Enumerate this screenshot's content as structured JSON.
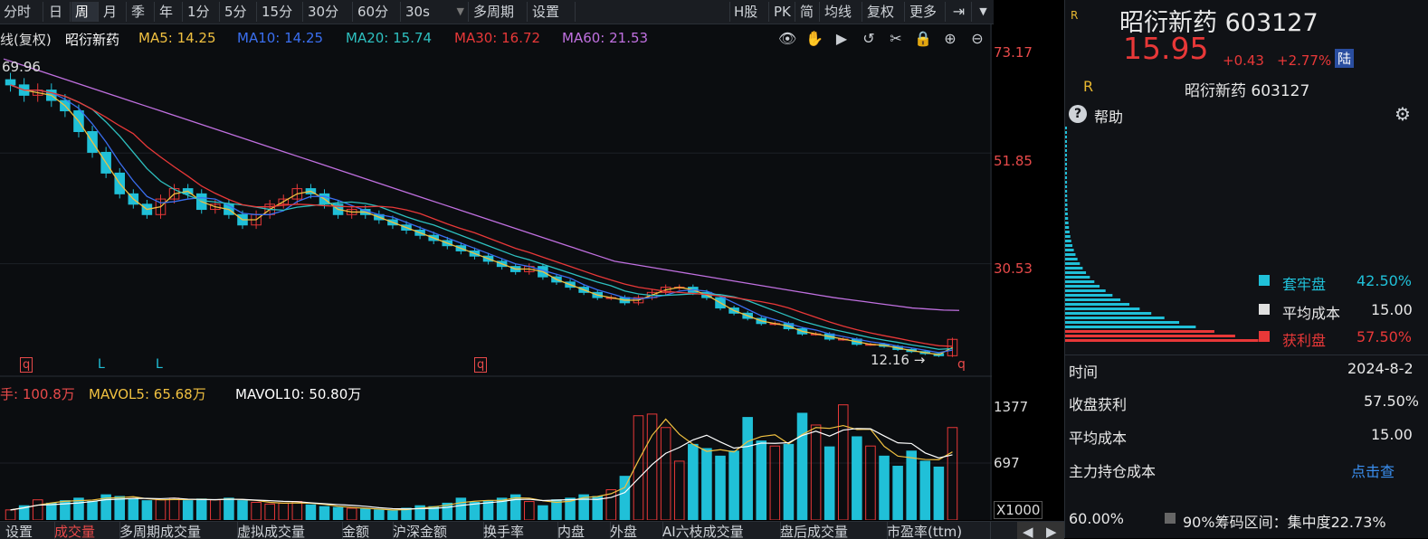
{
  "toolbar": {
    "items": [
      "分时",
      "日",
      "周",
      "月",
      "季",
      "年",
      "1分",
      "5分",
      "15分",
      "30分",
      "60分",
      "30s",
      "多周期",
      "设置"
    ],
    "right_items": [
      "H股",
      "PK",
      "简",
      "均线",
      "复权",
      "更多"
    ]
  },
  "chart": {
    "header_prefix": "线(复权)",
    "stock_name": "昭衍新药",
    "ma5": "MA5: 14.25",
    "ma10": "MA10: 14.25",
    "ma20": "MA20: 15.74",
    "ma30": "MA30: 16.72",
    "ma60": "MA60: 21.53",
    "max_label": "69.96",
    "min_label": "12.16",
    "y_ticks": [
      "73.17",
      "51.85",
      "30.53"
    ],
    "markers": [
      "q",
      "L",
      "L",
      "q",
      "q"
    ],
    "colors": {
      "ma5": "#f0c040",
      "ma10": "#3a6ff0",
      "ma20": "#2ec0c0",
      "ma30": "#e83838",
      "ma60": "#c070e0",
      "up": "#e83838",
      "down": "#20c0d8"
    }
  },
  "volume": {
    "vol_label": "手: 100.8万",
    "mavol5": "MAVOL5: 65.68万",
    "mavol10": "MAVOL10: 50.80万",
    "y_ticks": [
      "1377",
      "697"
    ],
    "unit": "X1000"
  },
  "chart_data": {
    "type": "candlestick",
    "y_range": [
      12.16,
      73.17
    ],
    "closes": [
      65,
      63,
      64,
      62,
      60,
      56,
      52,
      48,
      44,
      42,
      40,
      43,
      45,
      44,
      41,
      42,
      40,
      38,
      40,
      42,
      43,
      45,
      44,
      42,
      40,
      41,
      40,
      39,
      38,
      37,
      36,
      35,
      34,
      33,
      32,
      31,
      30,
      29,
      30,
      28,
      27,
      26,
      25,
      24,
      24,
      23,
      24,
      25,
      26,
      26,
      25,
      24,
      22,
      21,
      20,
      19,
      19,
      18,
      17,
      17,
      16,
      16,
      15,
      15,
      14.6,
      14,
      13.6,
      13.2,
      12.8,
      15.95
    ],
    "volumes": [
      120,
      170,
      240,
      200,
      230,
      260,
      220,
      300,
      280,
      250,
      230,
      240,
      260,
      230,
      250,
      240,
      260,
      230,
      210,
      190,
      200,
      220,
      180,
      160,
      150,
      140,
      130,
      120,
      110,
      140,
      170,
      160,
      200,
      260,
      210,
      230,
      260,
      300,
      220,
      170,
      240,
      260,
      300,
      280,
      360,
      520,
      1240,
      1260,
      1100,
      700,
      900,
      850,
      760,
      820,
      1220,
      940,
      880,
      900,
      1270,
      1130,
      870,
      1370,
      990,
      880,
      760,
      640,
      820,
      700,
      630,
      1100
    ],
    "ma60": [
      70,
      69,
      68,
      67,
      66,
      65,
      64,
      63,
      62,
      61,
      60,
      59,
      58,
      57,
      56,
      55,
      54,
      53,
      52,
      51,
      50,
      49,
      48,
      47,
      46,
      45,
      44,
      43,
      42,
      41,
      40,
      39,
      38,
      37,
      36,
      35,
      34,
      33,
      32,
      31,
      30.5,
      30,
      29.5,
      29,
      28.5,
      28,
      27.5,
      27,
      26.5,
      26,
      25.5,
      25,
      24.5,
      24,
      23.6,
      23.2,
      22.8,
      22.4,
      22,
      21.8,
      21.6,
      21.53
    ]
  },
  "right_panel": {
    "badge": "R",
    "title": "昭衍新药 603127",
    "price": "15.95",
    "change": "+0.43",
    "change_pct": "+2.77%",
    "exchange_tag": "陆",
    "sub_badge": "R",
    "sub_title": "昭衍新药 603127",
    "help": "帮助",
    "legend": [
      {
        "label": "套牢盘",
        "value": "42.50%",
        "color": "#20c0d8"
      },
      {
        "label": "平均成本",
        "value": "15.00",
        "color": "#e0e0e0"
      },
      {
        "label": "获利盘",
        "value": "57.50%",
        "color": "#e83838"
      }
    ],
    "rows": [
      {
        "label": "时间",
        "value": "2024-8-2"
      },
      {
        "label": "收盘获利",
        "value": "57.50%"
      },
      {
        "label": "平均成本",
        "value": "15.00"
      },
      {
        "label": "主力持仓成本",
        "value": "点击查"
      }
    ],
    "footer_left": "60.00%",
    "footer_mid": "90%筹码区间：集中度22.73%"
  },
  "bottom_tabs": [
    "设置",
    "成交量",
    "多周期成交量",
    "虚拟成交量",
    "金额",
    "沪深金额",
    "换手率",
    "内盘",
    "外盘",
    "AI六枝成交量",
    "盘后成交量",
    "市盈率(ttm)"
  ]
}
